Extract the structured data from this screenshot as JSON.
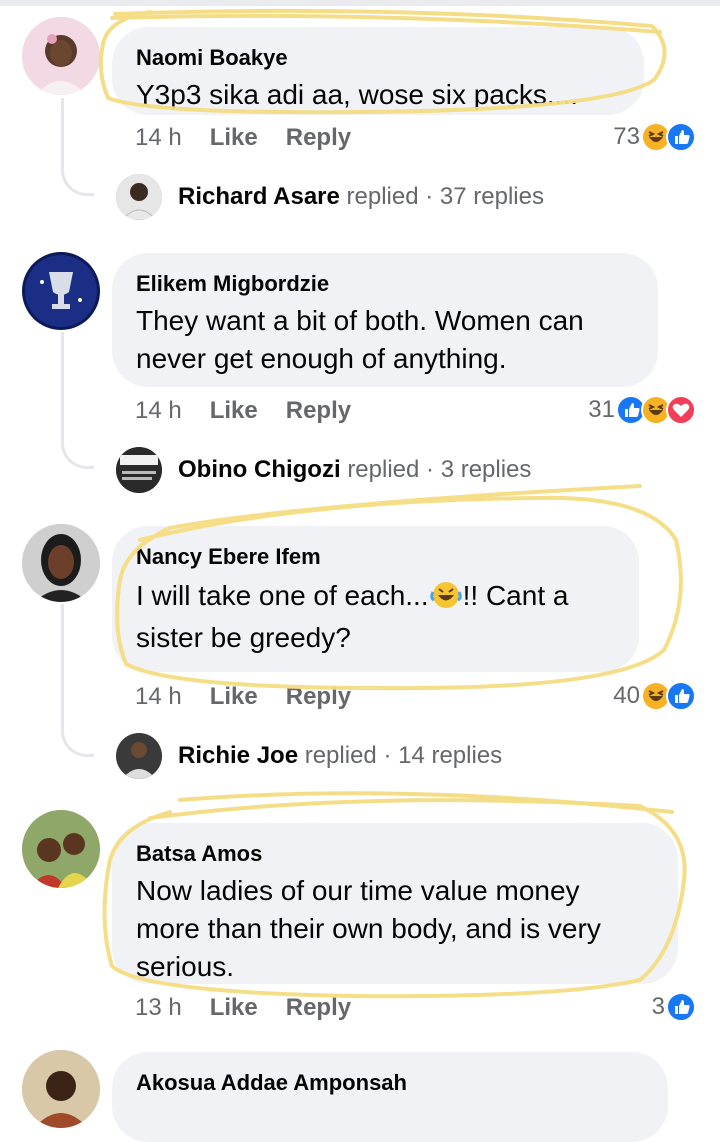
{
  "comments": [
    {
      "author": "Naomi Boakye",
      "text": "Y3p3 sika adi aa, wose six packs....",
      "time": "14 h",
      "like": "Like",
      "reply": "Reply",
      "reaction_count": "73",
      "reactions": [
        "haha-icon",
        "like-icon"
      ],
      "replied_by": "Richard Asare",
      "replied_word": "replied",
      "replies": "· 37 replies"
    },
    {
      "author": "Elikem Migbordzie",
      "text_line1": "They want a bit of both. Women can",
      "text_line2": "never get enough of anything.",
      "time": "14 h",
      "like": "Like",
      "reply": "Reply",
      "reaction_count": "31",
      "reactions": [
        "like-icon",
        "haha-icon",
        "love-icon"
      ],
      "replied_by": "Obino Chigozi",
      "replied_word": "replied",
      "replies": "· 3 replies"
    },
    {
      "author": "Nancy Ebere Ifem",
      "text_line1a": "I will take one of each...",
      "text_line1b": "!! Cant a",
      "text_line2": "sister be greedy?",
      "time": "14 h",
      "like": "Like",
      "reply": "Reply",
      "reaction_count": "40",
      "reactions": [
        "haha-icon",
        "like-icon"
      ],
      "replied_by": "Richie Joe",
      "replied_word": "replied",
      "replies": "· 14 replies"
    },
    {
      "author": "Batsa Amos",
      "text_line1": "Now ladies of our time value money",
      "text_line2": "more than their own body, and is very",
      "text_line3": "serious.",
      "time": "13 h",
      "like": "Like",
      "reply": "Reply",
      "reaction_count": "3",
      "reactions": [
        "like-icon"
      ]
    },
    {
      "author": "Akosua Addae Amponsah"
    }
  ],
  "colors": {
    "bubble": "#f0f2f5",
    "secondary_text": "#65676b",
    "like_blue": "#1877f2",
    "haha_yellow": "#f7b125",
    "love_red": "#f33e58",
    "highlight": "#f5dc82"
  }
}
